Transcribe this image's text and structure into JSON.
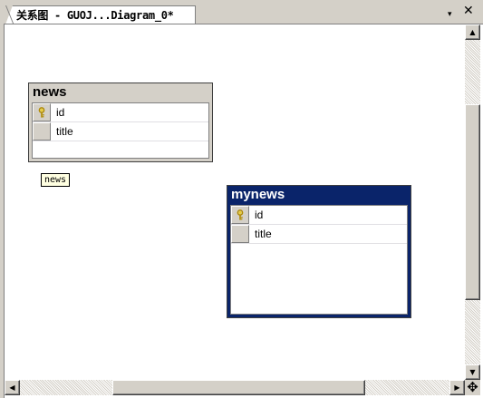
{
  "window": {
    "tab_title": "关系图 - GUOJ...Diagram_0*",
    "menu_glyph": "▾",
    "close_glyph": "✕"
  },
  "diagram": {
    "tables": [
      {
        "name": "news",
        "state": "inactive",
        "columns": [
          {
            "label": "id",
            "primary_key": true
          },
          {
            "label": "title",
            "primary_key": false
          }
        ]
      },
      {
        "name": "mynews",
        "state": "selected",
        "columns": [
          {
            "label": "id",
            "primary_key": true
          },
          {
            "label": "title",
            "primary_key": false
          }
        ]
      }
    ],
    "annotation": "news"
  },
  "scrollbars": {
    "up_glyph": "▲",
    "down_glyph": "▼",
    "left_glyph": "◀",
    "right_glyph": "▶",
    "corner_glyph": "✥"
  },
  "colors": {
    "selected_title_bg": "#0a246a",
    "inactive_title_bg": "#d4d0c8",
    "key_icon": "#d4b000",
    "annotation_bg": "#ffffe1"
  },
  "icons": {
    "primary_key": "key-icon"
  }
}
